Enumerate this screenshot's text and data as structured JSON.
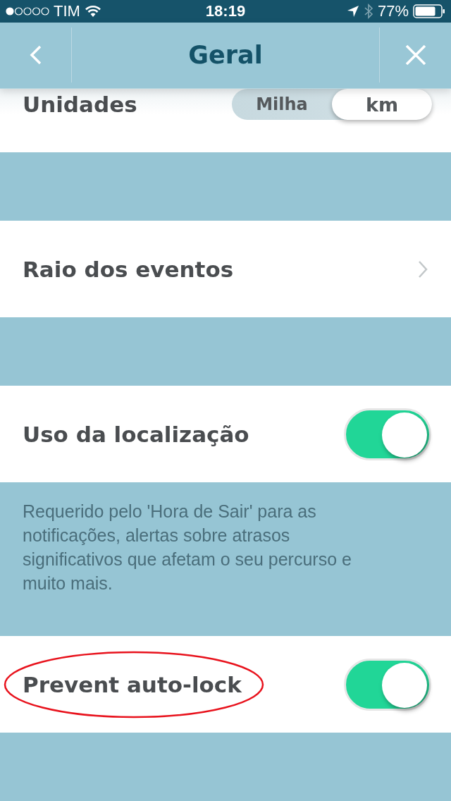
{
  "status_bar": {
    "carrier": "TIM",
    "time": "18:19",
    "battery": "77%"
  },
  "nav": {
    "title": "Geral"
  },
  "rows": [
    {
      "kind": "segmented",
      "label": "Unidades",
      "options": [
        {
          "label": "Milha",
          "selected": false
        },
        {
          "label": "km",
          "selected": true
        }
      ]
    },
    {
      "kind": "link",
      "label": "Raio dos eventos"
    },
    {
      "kind": "toggle",
      "label": "Uso da localização",
      "on": true,
      "note": "Requerido pelo 'Hora de Sair' para as notificações, alertas sobre atrasos significativos que afetam o seu percurso e muito mais."
    },
    {
      "kind": "toggle",
      "label": "Prevent auto-lock",
      "on": true,
      "circled": true
    }
  ]
}
